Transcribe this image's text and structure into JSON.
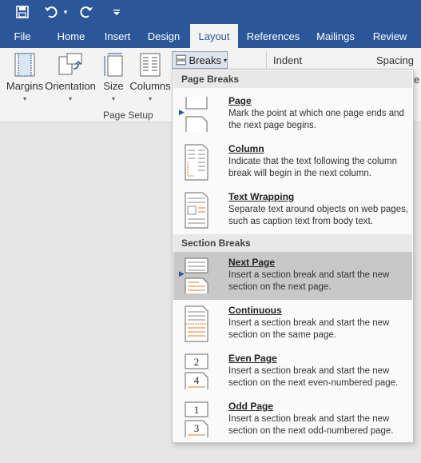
{
  "qat": {
    "save_icon": "save-icon",
    "undo_icon": "undo-icon",
    "undo_dropdown_icon": "chevron-down-icon",
    "redo_icon": "redo-icon",
    "customize_icon": "customize-qat-icon"
  },
  "tabs": [
    {
      "label": "File"
    },
    {
      "label": "Home"
    },
    {
      "label": "Insert"
    },
    {
      "label": "Design"
    },
    {
      "label": "Layout"
    },
    {
      "label": "References"
    },
    {
      "label": "Mailings"
    },
    {
      "label": "Review"
    }
  ],
  "ribbon": {
    "margins": "Margins",
    "orientation": "Orientation",
    "size": "Size",
    "columns": "Columns",
    "breaks": "Breaks",
    "group_label": "Page Setup",
    "indent": "Indent",
    "spacing": "Spacing",
    "cut_off_char": "e"
  },
  "dropdown": {
    "page_breaks_header": "Page Breaks",
    "section_breaks_header": "Section Breaks",
    "items": [
      {
        "title": "Page",
        "desc": "Mark the point at which one page ends and the next page begins."
      },
      {
        "title": "Column",
        "desc": "Indicate that the text following the column break will begin in the next column."
      },
      {
        "title": "Text Wrapping",
        "desc": "Separate text around objects on web pages, such as caption text from body text."
      },
      {
        "title": "Next Page",
        "desc": "Insert a section break and start the new section on the next page."
      },
      {
        "title": "Continuous",
        "desc": "Insert a section break and start the new section on the same page."
      },
      {
        "title": "Even Page",
        "desc": "Insert a section break and start the new section on the next even-numbered page."
      },
      {
        "title": "Odd Page",
        "desc": "Insert a section break and start the new section on the next odd-numbered page."
      }
    ],
    "even_digits": [
      "2",
      "4"
    ],
    "odd_digits": [
      "1",
      "3"
    ]
  },
  "colors": {
    "brand": "#2b579a",
    "accent_orange": "#e07b28",
    "selected_bg": "#c8c8c8"
  }
}
